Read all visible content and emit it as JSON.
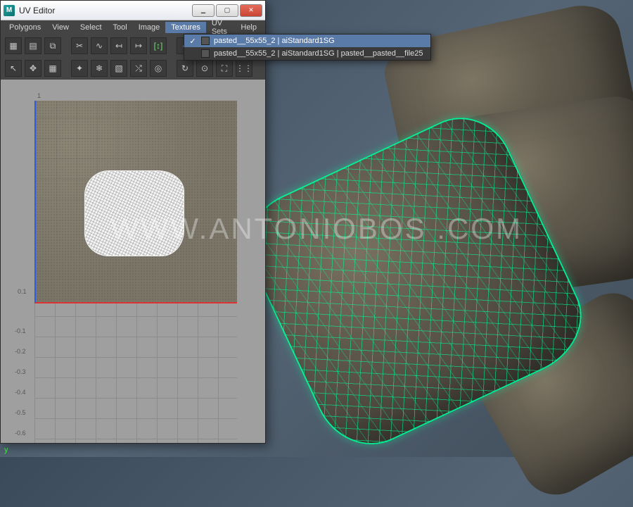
{
  "window": {
    "title": "UV Editor",
    "app_initial": "M"
  },
  "menubar": {
    "items": [
      "Polygons",
      "View",
      "Select",
      "Tool",
      "Image",
      "Textures",
      "UV Sets",
      "Help"
    ],
    "open_index": 5
  },
  "textures_dropdown": {
    "items": [
      {
        "checked": true,
        "label": "pasted__55x55_2 | aiStandard1SG"
      },
      {
        "checked": false,
        "label": "pasted__55x55_2 | aiStandard1SG | pasted__pasted__file25"
      }
    ],
    "selected_index": 0
  },
  "toolbar_row1": [
    {
      "name": "uv-shell-icon",
      "glyph": "▦"
    },
    {
      "name": "uv-border-icon",
      "glyph": "▤"
    },
    {
      "name": "lattice-icon",
      "glyph": "⧉"
    },
    {
      "name": "cut-icon",
      "glyph": "✂"
    },
    {
      "name": "sew-icon",
      "glyph": "∿"
    },
    {
      "name": "arrow-left-icon",
      "glyph": "↤"
    },
    {
      "name": "arrow-right-icon",
      "glyph": "↦"
    },
    {
      "name": "brackets-icon",
      "glyph": "[↕]",
      "accent": true
    },
    {
      "name": "cycle-icon",
      "glyph": "◐"
    },
    {
      "name": "flip-u-icon",
      "glyph": "⇆"
    },
    {
      "name": "flip-v-icon",
      "glyph": "⇅"
    }
  ],
  "toolbar_row2": [
    {
      "name": "select-arrow-icon",
      "glyph": "↖"
    },
    {
      "name": "move-icon",
      "glyph": "✥"
    },
    {
      "name": "grid-icon",
      "glyph": "▦"
    },
    {
      "name": "magic-icon",
      "glyph": "✦"
    },
    {
      "name": "snowflake-icon",
      "glyph": "❄"
    },
    {
      "name": "layout-icon",
      "glyph": "▧"
    },
    {
      "name": "swap-icon",
      "glyph": "⤭"
    },
    {
      "name": "target-icon",
      "glyph": "◎"
    },
    {
      "name": "refresh-icon",
      "glyph": "↻"
    },
    {
      "name": "pin-icon",
      "glyph": "⊙"
    },
    {
      "name": "frame-icon",
      "glyph": "⛶"
    },
    {
      "name": "dots-icon",
      "glyph": "⋮⋮"
    }
  ],
  "uv_axes": {
    "top_tick": "1",
    "left_ticks": [
      "0.1",
      "-0.1",
      "-0.2",
      "-0.3",
      "-0.4",
      "-0.5",
      "-0.6"
    ]
  },
  "watermark": "WWW.ANTONIOBOS  .COM",
  "gizmo": {
    "y": "y"
  }
}
